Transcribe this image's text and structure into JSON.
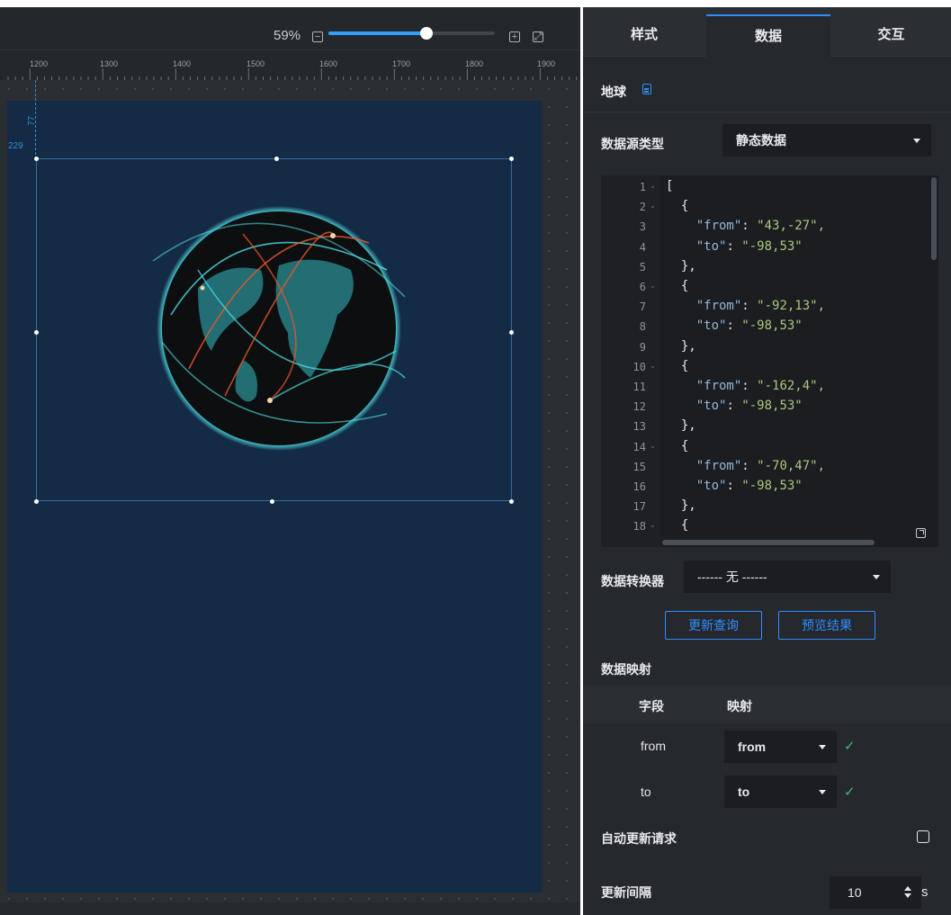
{
  "toolbar": {
    "zoom": "59%",
    "zoom_level": 0.59,
    "zoom_out_icon": "minus-square-icon",
    "zoom_in_icon": "plus-square-icon",
    "fit_icon": "expand-icon"
  },
  "ruler": {
    "ticks": [
      "1200",
      "1300",
      "1400",
      "1500",
      "1600",
      "1700",
      "1800",
      "1900"
    ]
  },
  "canvas": {
    "coord_x": "229",
    "coord_y": "77",
    "component": "globe-flight-lines",
    "colors": {
      "screen": "#142b45",
      "globe": "#0c0e10",
      "glow": "#4fe3e8",
      "arc_red": "#e8572b"
    }
  },
  "panel": {
    "tabs": [
      "样式",
      "数据",
      "交互"
    ],
    "active_tab": "数据",
    "component_title": "地球",
    "title_icon": "document-icon",
    "source_type_label": "数据源类型",
    "source_type_value": "静态数据",
    "code_lines": [
      {
        "n": "1",
        "fold": true,
        "text": "["
      },
      {
        "n": "2",
        "fold": true,
        "text": "  {"
      },
      {
        "n": "3",
        "fold": false,
        "key": "\"from\"",
        "val": "\"43,-27\","
      },
      {
        "n": "4",
        "fold": false,
        "key": "\"to\"",
        "val": "\"-98,53\""
      },
      {
        "n": "5",
        "fold": false,
        "text": "  },"
      },
      {
        "n": "6",
        "fold": true,
        "text": "  {"
      },
      {
        "n": "7",
        "fold": false,
        "key": "\"from\"",
        "val": "\"-92,13\","
      },
      {
        "n": "8",
        "fold": false,
        "key": "\"to\"",
        "val": "\"-98,53\""
      },
      {
        "n": "9",
        "fold": false,
        "text": "  },"
      },
      {
        "n": "10",
        "fold": true,
        "text": "  {"
      },
      {
        "n": "11",
        "fold": false,
        "key": "\"from\"",
        "val": "\"-162,4\","
      },
      {
        "n": "12",
        "fold": false,
        "key": "\"to\"",
        "val": "\"-98,53\""
      },
      {
        "n": "13",
        "fold": false,
        "text": "  },"
      },
      {
        "n": "14",
        "fold": true,
        "text": "  {"
      },
      {
        "n": "15",
        "fold": false,
        "key": "\"from\"",
        "val": "\"-70,47\","
      },
      {
        "n": "16",
        "fold": false,
        "key": "\"to\"",
        "val": "\"-98,53\""
      },
      {
        "n": "17",
        "fold": false,
        "text": "  },"
      },
      {
        "n": "18",
        "fold": true,
        "text": "  {"
      }
    ],
    "converter_label": "数据转换器",
    "converter_value": "------ 无 ------",
    "refresh_button": "更新查询",
    "preview_button": "预览结果",
    "mapping_title": "数据映射",
    "mapping_col_field": "字段",
    "mapping_col_map": "映射",
    "mappings": [
      {
        "field": "from",
        "value": "from"
      },
      {
        "field": "to",
        "value": "to"
      }
    ],
    "auto_update_label": "自动更新请求",
    "auto_update_checked": false,
    "interval_label": "更新间隔",
    "interval_value": "10",
    "interval_unit": "s",
    "accent": "#2f8fff",
    "ok_color": "#38c172"
  }
}
